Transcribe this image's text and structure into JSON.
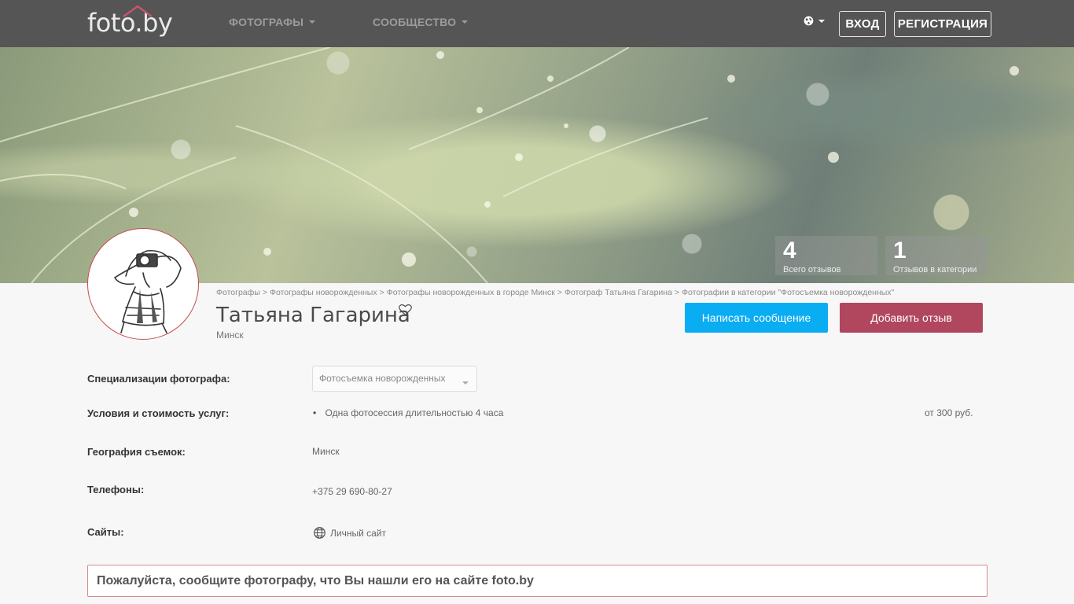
{
  "header": {
    "logo_text": "foto.by",
    "nav": [
      {
        "label": "ФОТОГРАФЫ"
      },
      {
        "label": "СООБЩЕСТВО"
      }
    ],
    "login_label": "ВХОД",
    "register_label": "РЕГИСТРАЦИЯ",
    "language_icon": "globe-icon"
  },
  "hero": {
    "stats": [
      {
        "value": "4",
        "label": "Всего отзывов"
      },
      {
        "value": "1",
        "label": "Отзывов в категории"
      }
    ]
  },
  "breadcrumb": [
    "Фотографы",
    "Фотографы новорожденных",
    "Фотографы новорожденных в городе Минск",
    "Фотограф Татьяна Гагарина",
    "Фотографии в категории \"Фотосъемка новорожденных\""
  ],
  "breadcrumb_separator": ">",
  "profile": {
    "name": "Татьяна Гагарина",
    "city": "Минск",
    "write_message_label": "Написать сообщение",
    "add_review_label": "Добавить отзыв"
  },
  "details": {
    "specializations_label": "Специализации фотографа:",
    "specialization_selected": "Фотосъемка новорожденных",
    "conditions_label": "Условия и стоимость услуг:",
    "service_bullet": "•",
    "service_text": "Одна фотосессия длительностью 4 часа",
    "service_price": "от 300 руб.",
    "geography_label": "География съемок:",
    "geography_value": "Минск",
    "phones_label": "Телефоны:",
    "phone_value": "+375 29 690-80-27",
    "sites_label": "Сайты:",
    "site_value": "Личный сайт"
  },
  "notice_text": "Пожалуйста, сообщите фотографу, что Вы нашли его на сайте foto.by",
  "colors": {
    "nav_bg": "#555555",
    "primary_blue": "#0aacf2",
    "review_red": "#b0475f",
    "accent_border": "#d98a8a"
  }
}
